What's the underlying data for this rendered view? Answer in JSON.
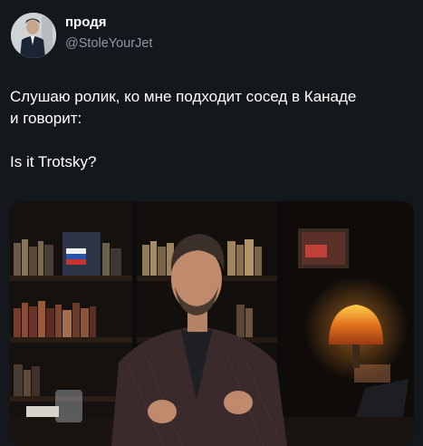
{
  "author": {
    "display_name": "продя",
    "handle": "@StoleYourJet",
    "avatar_icon": "avatar-photo-icon"
  },
  "tweet": {
    "line1": "Слушаю ролик, ко мне подходит сосед в Канаде",
    "line2": "и говорит:",
    "line3": "Is it Trotsky?"
  },
  "media": {
    "description_icon": "video-frame-icon"
  },
  "colors": {
    "background": "#14171c",
    "text": "#ffffff",
    "muted": "#8b98a5"
  }
}
